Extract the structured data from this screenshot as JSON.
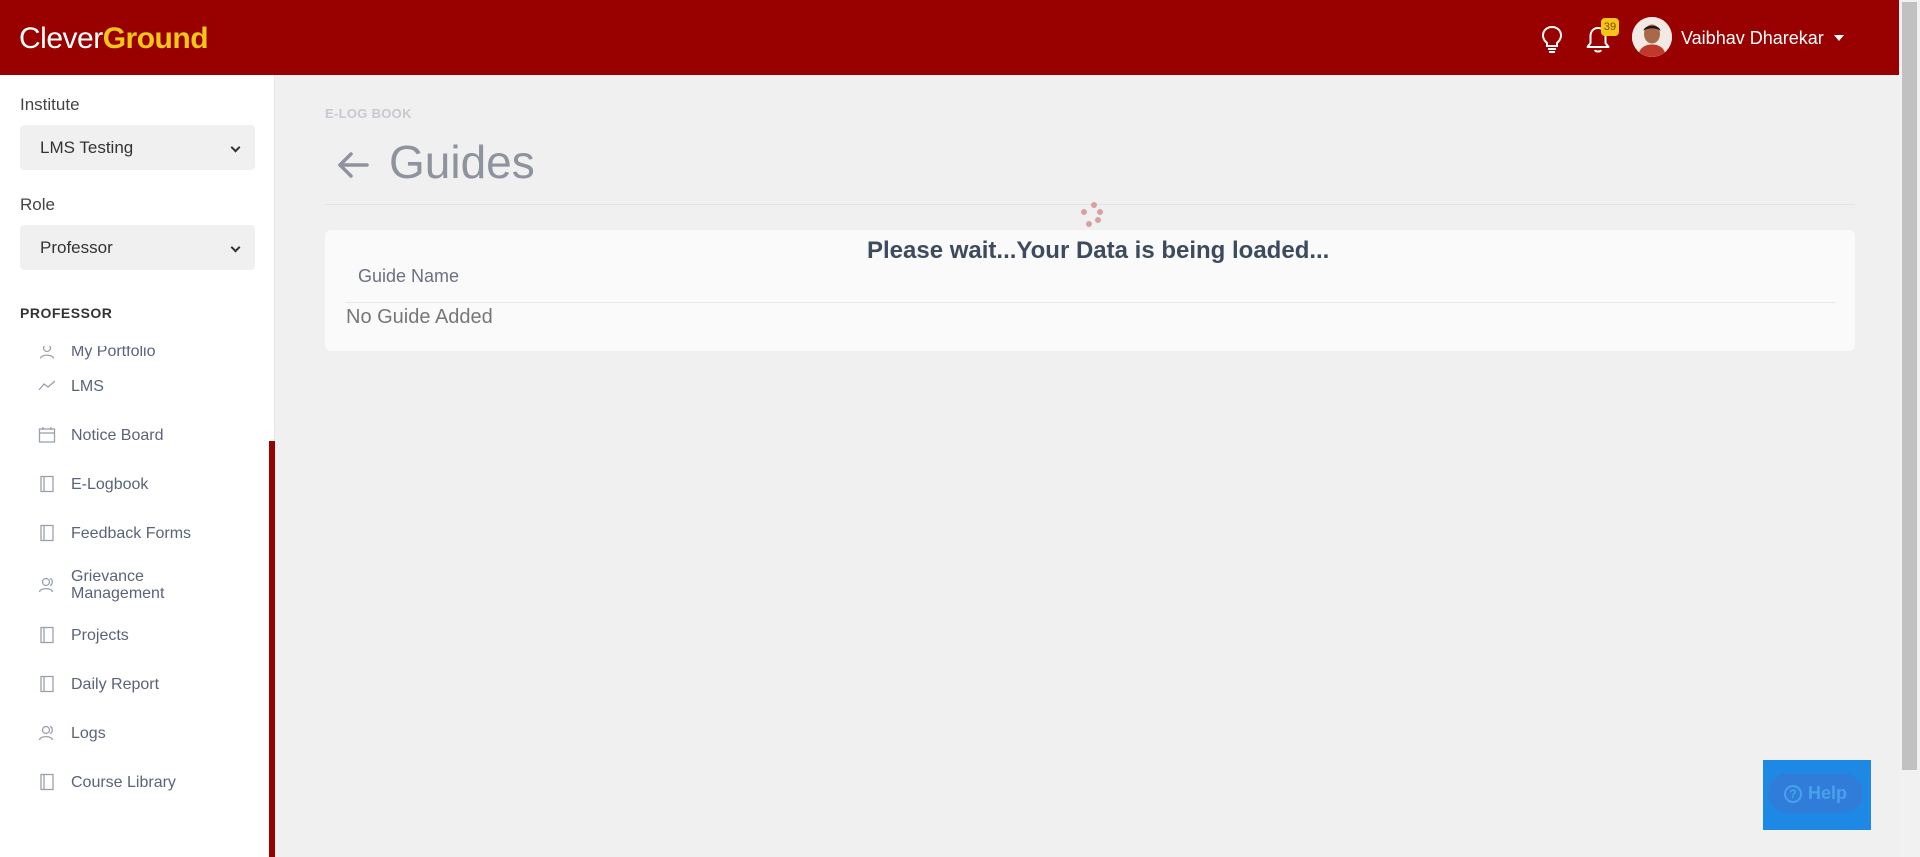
{
  "header": {
    "logo_part1": "Clever",
    "logo_part2": "Ground",
    "notification_count": "39",
    "user_name": "Vaibhav Dharekar",
    "brand_color": "#990000",
    "accent_color": "#f5c518"
  },
  "sidebar": {
    "institute_label": "Institute",
    "institute_value": "LMS Testing",
    "role_label": "Role",
    "role_value": "Professor",
    "section_title": "PROFESSOR",
    "items": [
      {
        "label": "My Portfolio",
        "icon": "person-icon"
      },
      {
        "label": "LMS",
        "icon": "trend-icon"
      },
      {
        "label": "Notice Board",
        "icon": "calendar-icon"
      },
      {
        "label": "E-Logbook",
        "icon": "book-icon"
      },
      {
        "label": "Feedback Forms",
        "icon": "book-icon"
      },
      {
        "label": "Grievance Management",
        "icon": "user-group-icon"
      },
      {
        "label": "Projects",
        "icon": "book-icon"
      },
      {
        "label": "Daily Report",
        "icon": "book-icon"
      },
      {
        "label": "Logs",
        "icon": "user-group-icon"
      },
      {
        "label": "Course Library",
        "icon": "book-icon"
      }
    ]
  },
  "main": {
    "breadcrumb": "E-LOG BOOK",
    "title": "Guides",
    "loading_message": "Please wait...Your Data is being loaded...",
    "column_header": "Guide Name",
    "empty_message": "No Guide Added"
  },
  "help": {
    "label": "Help"
  }
}
